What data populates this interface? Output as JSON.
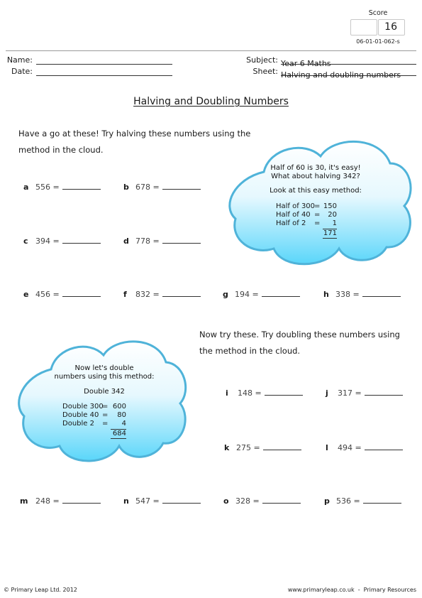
{
  "header": {
    "score_label": "Score",
    "score_value": "16",
    "sheet_code": "06-01-01-062-s",
    "name_label": "Name:",
    "name_value": "",
    "date_label": "Date:",
    "date_value": "",
    "subject_label": "Subject:",
    "subject_value": "Year 6 Maths",
    "sheet_label": "Sheet:",
    "sheet_value": "Halving and doubling numbers"
  },
  "title": "Halving and Doubling Numbers",
  "halving": {
    "instruction_line1": "Have a go at these! Try halving these numbers using the",
    "instruction_line2": "method in the cloud.",
    "questions": [
      {
        "letter": "a",
        "number": "556 =",
        "answer": ""
      },
      {
        "letter": "b",
        "number": "678 =",
        "answer": ""
      },
      {
        "letter": "c",
        "number": "394 =",
        "answer": ""
      },
      {
        "letter": "d",
        "number": "778 =",
        "answer": ""
      },
      {
        "letter": "e",
        "number": "456 =",
        "answer": ""
      },
      {
        "letter": "f",
        "number": "832 =",
        "answer": ""
      },
      {
        "letter": "g",
        "number": "194 =",
        "answer": ""
      },
      {
        "letter": "h",
        "number": "338 =",
        "answer": ""
      }
    ],
    "cloud": {
      "line1": "Half of 60 is 30, it's easy!",
      "line2": "What about halving 342?",
      "line3": "Look at this easy method:",
      "rows": [
        {
          "label": "Half of 300",
          "eq": "=",
          "value": "150"
        },
        {
          "label": "Half of 40",
          "eq": "=",
          "value": "20"
        },
        {
          "label": "Half of 2",
          "eq": "=",
          "value": "1"
        }
      ],
      "total": "171"
    }
  },
  "doubling": {
    "instruction_line1": "Now try these. Try doubling these numbers using",
    "instruction_line2": "the method in the cloud.",
    "questions": [
      {
        "letter": "i",
        "number": "148 =",
        "answer": ""
      },
      {
        "letter": "j",
        "number": "317 =",
        "answer": ""
      },
      {
        "letter": "k",
        "number": "275 =",
        "answer": ""
      },
      {
        "letter": "l",
        "number": "494 =",
        "answer": ""
      },
      {
        "letter": "m",
        "number": "248 =",
        "answer": ""
      },
      {
        "letter": "n",
        "number": "547 =",
        "answer": ""
      },
      {
        "letter": "o",
        "number": "328 =",
        "answer": ""
      },
      {
        "letter": "p",
        "number": "536 =",
        "answer": ""
      }
    ],
    "cloud": {
      "line1": "Now let's double",
      "line2": "numbers using this method:",
      "line3": "Double 342",
      "rows": [
        {
          "label": "Double 300",
          "eq": "=",
          "value": "600"
        },
        {
          "label": "Double 40",
          "eq": "=",
          "value": "80"
        },
        {
          "label": "Double 2",
          "eq": "=",
          "value": "4"
        }
      ],
      "total": "684"
    }
  },
  "colors": {
    "cloud_stroke": "#4fb3d9",
    "cloud_fill_top": "#ffffff",
    "cloud_fill_bottom": "#5ad6fa"
  },
  "footer": {
    "left": "© Primary Leap Ltd. 2012",
    "right": "www.primaryleap.co.uk  -  Primary Resources"
  }
}
